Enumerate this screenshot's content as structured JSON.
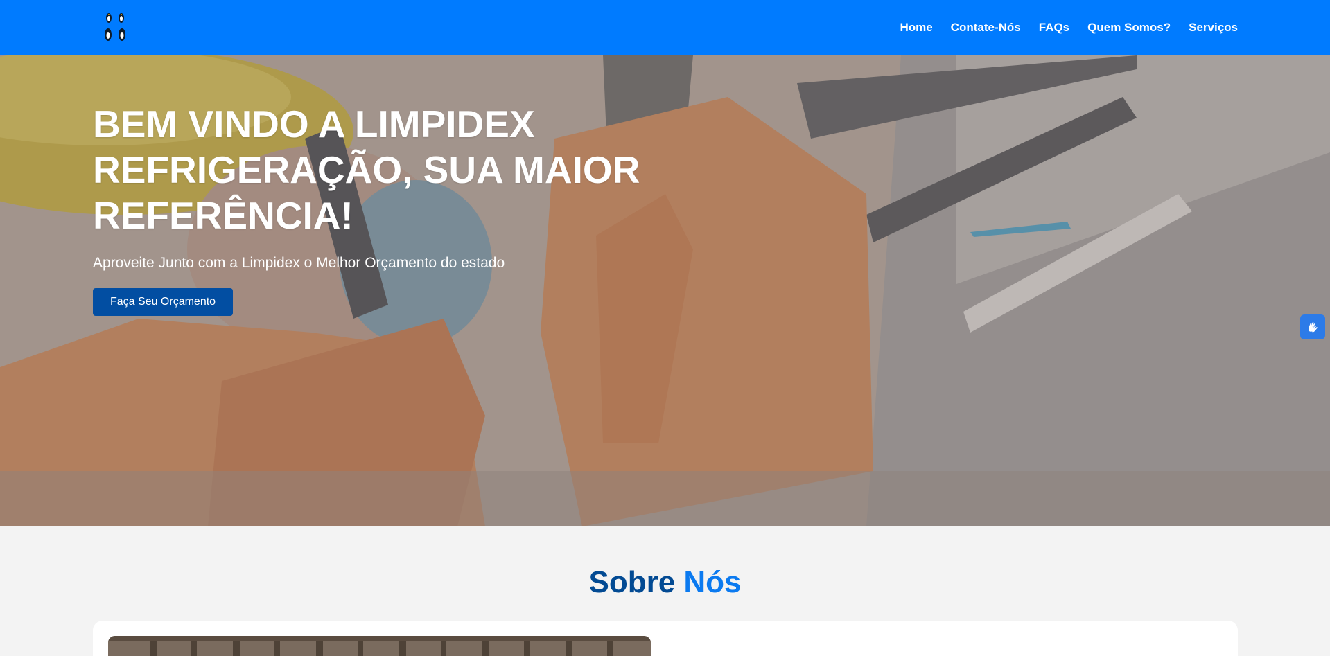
{
  "nav": {
    "logo_icon": "penguins-logo-icon",
    "links": [
      "Home",
      "Contate-Nós",
      "FAQs",
      "Quem Somos?",
      "Serviços"
    ]
  },
  "hero": {
    "title": "BEM VINDO A LIMPIDEX REFRIGERAÇÃO, SUA MAIOR REFERÊNCIA!",
    "subtitle": "Aproveite Junto com a Limpidex o Melhor Orçamento do estado",
    "cta_label": "Faça Seu Orçamento"
  },
  "about": {
    "title_part1": "Sobre",
    "title_part2": "Nós"
  },
  "accessibility": {
    "icon": "sign-language-hands-icon"
  },
  "colors": {
    "nav_bg": "#007bff",
    "cta_bg": "#024ea2",
    "about_title_dark": "#024a93",
    "about_title_light": "#0b7af0"
  }
}
